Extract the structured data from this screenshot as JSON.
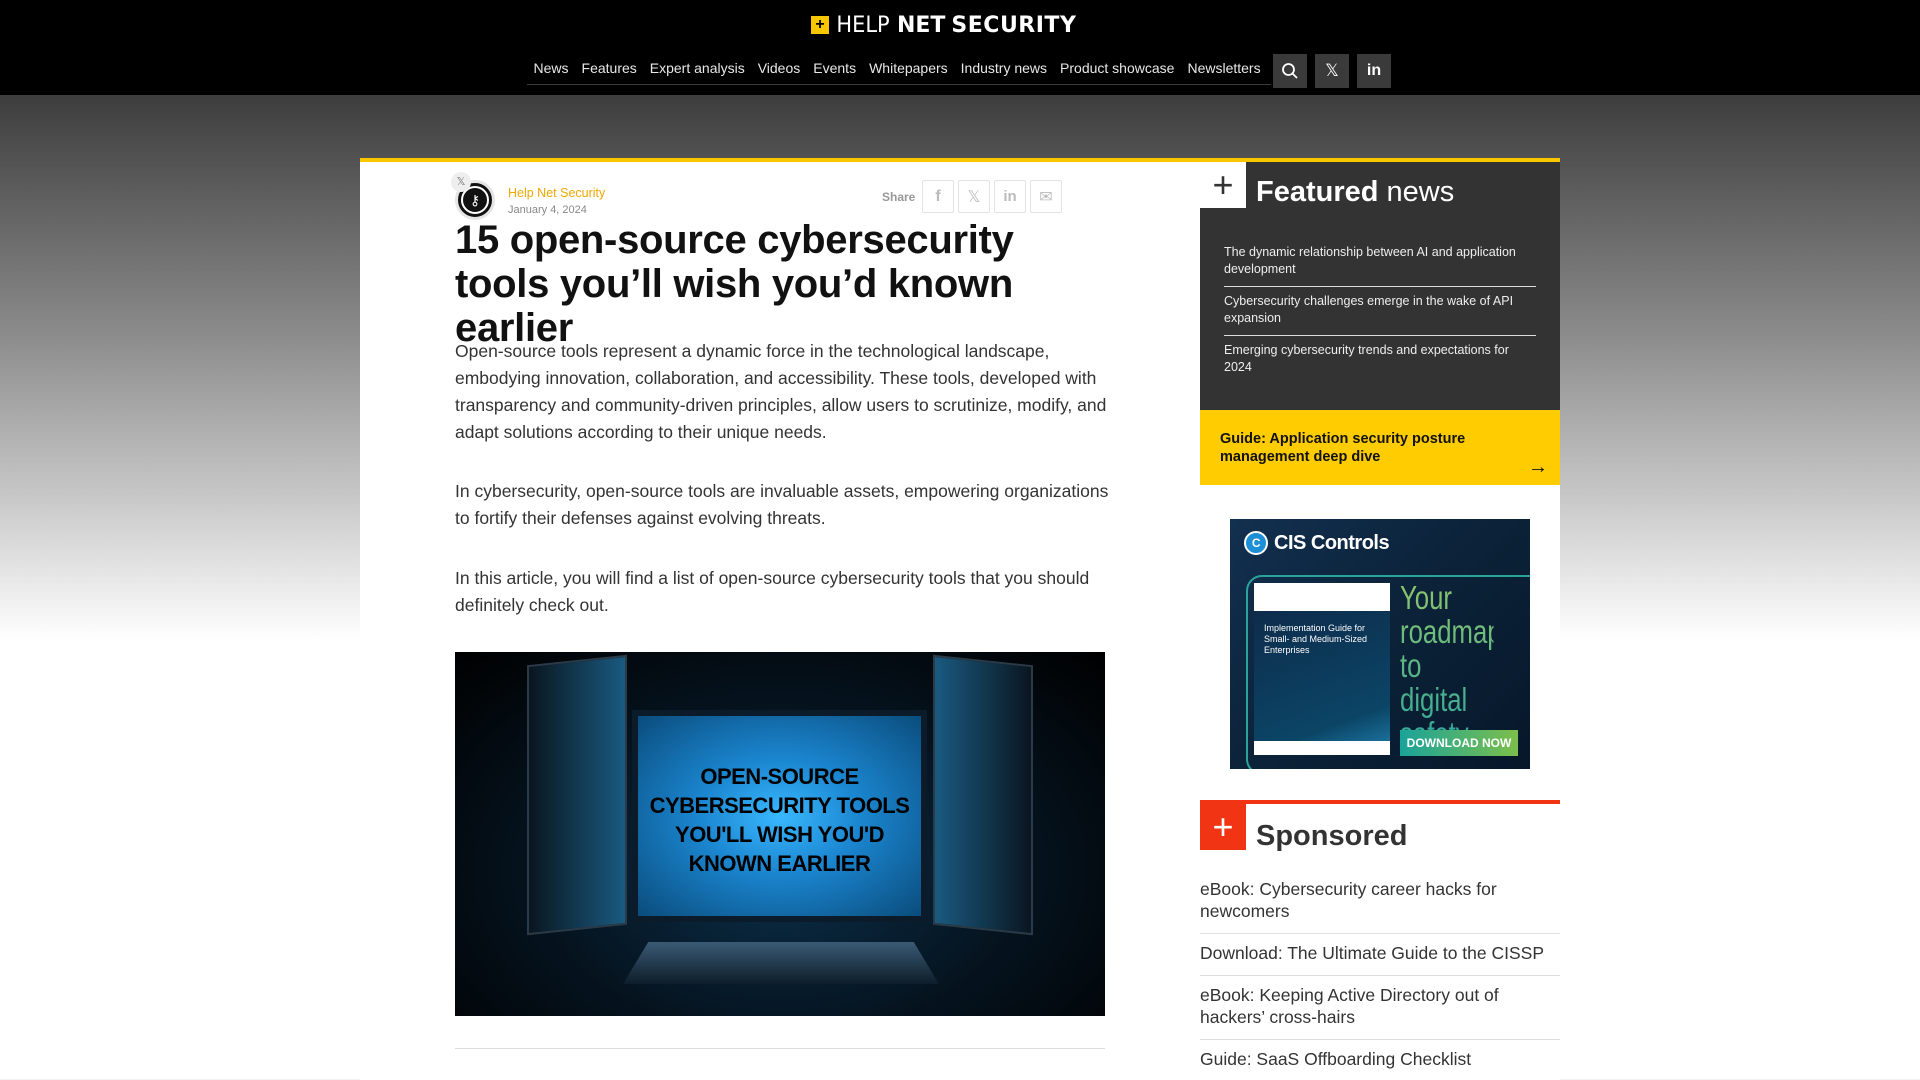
{
  "header": {
    "logo": {
      "plus": "+",
      "help": "HELP",
      "net": "NET",
      "security": "SECURITY"
    },
    "nav": [
      "News",
      "Features",
      "Expert analysis",
      "Videos",
      "Events",
      "Whitepapers",
      "Industry news",
      "Product showcase",
      "Newsletters"
    ],
    "icons": {
      "search": "search-icon",
      "x": "x-icon",
      "linkedin": "linkedin-icon"
    },
    "x_glyph": "𝕏",
    "linkedin_glyph": "in",
    "search_glyph": "⚲"
  },
  "colors": {
    "brand_yellow": "#f8c700",
    "sponsored_red": "#f03414",
    "featured_bg": "#333333",
    "author_orange": "#f0a800"
  },
  "article": {
    "author": "Help Net Security",
    "date": "January 4, 2024",
    "share_label": "Share",
    "share_buttons": [
      {
        "name": "facebook",
        "glyph": "f"
      },
      {
        "name": "x",
        "glyph": "𝕏"
      },
      {
        "name": "linkedin",
        "glyph": "in"
      },
      {
        "name": "email",
        "glyph": "✉"
      }
    ],
    "x_badge": "𝕏",
    "avatar_glyph": "⚷",
    "title": "15 open-source cybersecurity tools you’ll wish you’d known earlier",
    "paragraphs": [
      "Open-source tools represent a dynamic force in the technological landscape, embodying innovation, collaboration, and accessibility. These tools, developed with transparency and community-driven principles, allow users to scrutinize, modify, and adapt solutions according to their unique needs.",
      "In cybersecurity, open-source tools are invaluable assets, empowering organizations to fortify their defenses against evolving threats.",
      "In this article, you will find a list of open-source cybersecurity tools that you should definitely check out."
    ],
    "hero_text": [
      "OPEN-SOURCE",
      "CYBERSECURITY TOOLS",
      "YOU'LL WISH YOU'D",
      "KNOWN EARLIER"
    ]
  },
  "sidebar": {
    "featured": {
      "plus": "+",
      "title_bold": "Featured",
      "title_rest": " news",
      "items": [
        "The dynamic relationship between AI and application development",
        "Cybersecurity challenges emerge in the wake of API expansion",
        "Emerging cybersecurity trends and expectations for 2024"
      ]
    },
    "guide": {
      "text": "Guide: Application security posture management deep dive",
      "arrow": "→"
    },
    "ad": {
      "brand": "CIS Controls",
      "brand_glyph": "C",
      "book_title": "Implementation Guide for Small- and Medium-Sized Enterprises",
      "tagline": "Your roadmap to digital safety.",
      "cta": "DOWNLOAD NOW"
    },
    "sponsored": {
      "plus": "+",
      "title": "Sponsored",
      "items": [
        "eBook: Cybersecurity career hacks for newcomers",
        "Download: The Ultimate Guide to the CISSP",
        "eBook: Keeping Active Directory out of hackers’ cross-hairs",
        "Guide: SaaS Offboarding Checklist"
      ]
    }
  }
}
